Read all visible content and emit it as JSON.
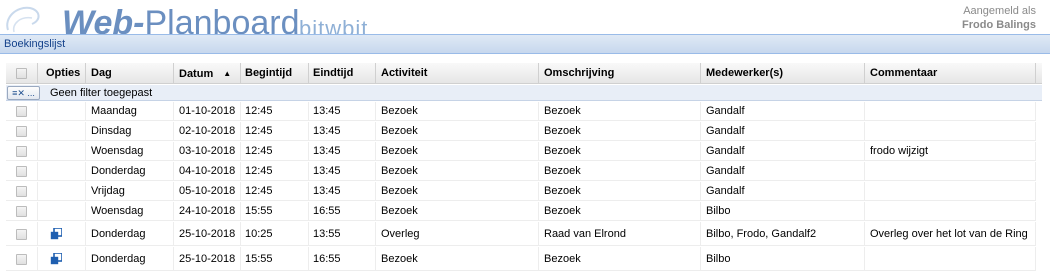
{
  "app": {
    "logo_main": "Web-",
    "logo_rest": "Planboard",
    "logo_sub": "bitwbit",
    "logged_in_label": "Aangemeld als",
    "user_name": "Frodo Balings"
  },
  "panel": {
    "title": "Boekingslijst"
  },
  "grid": {
    "columns": [
      "",
      "Opties",
      "Dag",
      "Datum",
      "Begintijd",
      "Eindtijd",
      "Activiteit",
      "Omschrijving",
      "Medewerker(s)",
      "Commentaar"
    ],
    "sort_indicator": "▲",
    "filter_button_label": "≡✕ ...",
    "filter_text": "Geen filter toegepast",
    "rows": [
      {
        "opties": "",
        "dag": "Maandag",
        "datum": "01-10-2018",
        "begin": "12:45",
        "eind": "13:45",
        "activiteit": "Bezoek",
        "omschrijving": "Bezoek",
        "medewerkers": "Gandalf",
        "commentaar": ""
      },
      {
        "opties": "",
        "dag": "Dinsdag",
        "datum": "02-10-2018",
        "begin": "12:45",
        "eind": "13:45",
        "activiteit": "Bezoek",
        "omschrijving": "Bezoek",
        "medewerkers": "Gandalf",
        "commentaar": ""
      },
      {
        "opties": "",
        "dag": "Woensdag",
        "datum": "03-10-2018",
        "begin": "12:45",
        "eind": "13:45",
        "activiteit": "Bezoek",
        "omschrijving": "Bezoek",
        "medewerkers": "Gandalf",
        "commentaar": "frodo wijzigt"
      },
      {
        "opties": "",
        "dag": "Donderdag",
        "datum": "04-10-2018",
        "begin": "12:45",
        "eind": "13:45",
        "activiteit": "Bezoek",
        "omschrijving": "Bezoek",
        "medewerkers": "Gandalf",
        "commentaar": ""
      },
      {
        "opties": "",
        "dag": "Vrijdag",
        "datum": "05-10-2018",
        "begin": "12:45",
        "eind": "13:45",
        "activiteit": "Bezoek",
        "omschrijving": "Bezoek",
        "medewerkers": "Gandalf",
        "commentaar": ""
      },
      {
        "opties": "",
        "dag": "Woensdag",
        "datum": "24-10-2018",
        "begin": "15:55",
        "eind": "16:55",
        "activiteit": "Bezoek",
        "omschrijving": "Bezoek",
        "medewerkers": "Bilbo",
        "commentaar": ""
      },
      {
        "opties": "copy-icon",
        "dag": "Donderdag",
        "datum": "25-10-2018",
        "begin": "10:25",
        "eind": "13:55",
        "activiteit": "Overleg",
        "omschrijving": "Raad van Elrond",
        "medewerkers": "Bilbo, Frodo, Gandalf2",
        "commentaar": "Overleg over het lot van de Ring"
      },
      {
        "opties": "copy-icon",
        "dag": "Donderdag",
        "datum": "25-10-2018",
        "begin": "15:55",
        "eind": "16:55",
        "activiteit": "Bezoek",
        "omschrijving": "Bezoek",
        "medewerkers": "Bilbo",
        "commentaar": ""
      }
    ]
  },
  "colors": {
    "accent": "#15428b",
    "logo": "#6b8fc0",
    "icon": "#1f5fb0"
  }
}
